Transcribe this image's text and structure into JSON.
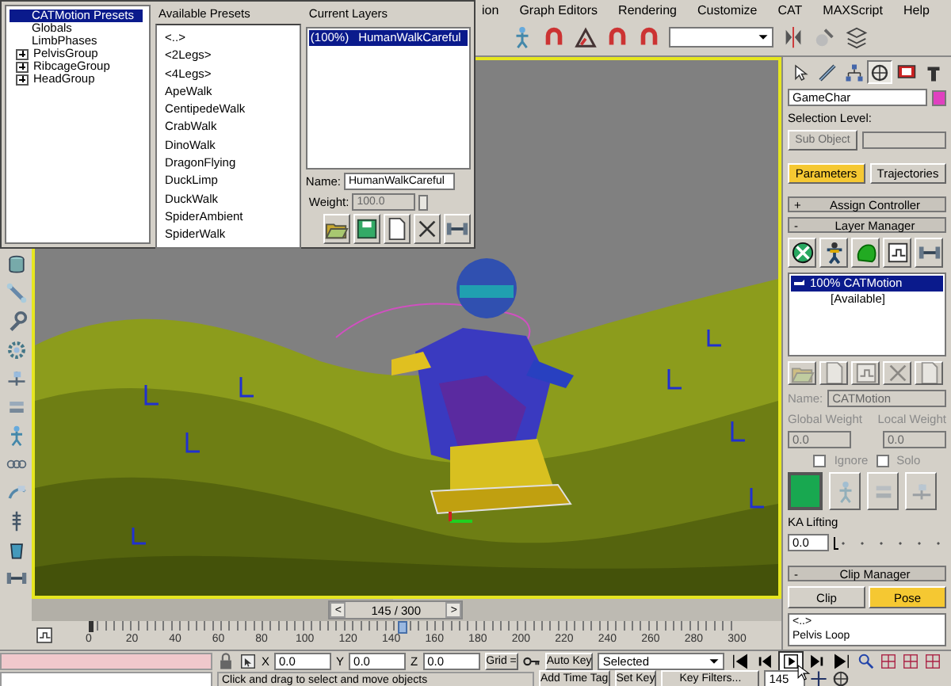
{
  "menu_bar": {
    "items": [
      "ion",
      "Graph Editors",
      "Rendering",
      "Customize",
      "CAT",
      "MAXScript",
      "Help"
    ]
  },
  "catmotion_window": {
    "tree": [
      {
        "label": "CATMotion Presets",
        "kind": "item",
        "selected": true,
        "children": [
          {
            "label": "Globals",
            "kind": "item",
            "selected": false
          },
          {
            "label": "LimbPhases",
            "kind": "item",
            "selected": false
          },
          {
            "label": "PelvisGroup",
            "kind": "group",
            "expanded": false,
            "selected": false
          },
          {
            "label": "RibcageGroup",
            "kind": "group",
            "expanded": false,
            "selected": false
          },
          {
            "label": "HeadGroup",
            "kind": "group",
            "expanded": false,
            "selected": false
          }
        ]
      }
    ],
    "available_presets": {
      "heading": "Available Presets",
      "items": [
        {
          "label": "<..>",
          "selected": false
        },
        {
          "label": "<2Legs>",
          "selected": false
        },
        {
          "label": "<4Legs>",
          "selected": false
        },
        {
          "label": "ApeWalk",
          "selected": false
        },
        {
          "label": "CentipedeWalk",
          "selected": false
        },
        {
          "label": "CrabWalk",
          "selected": false
        },
        {
          "label": "DinoWalk",
          "selected": false
        },
        {
          "label": "DragonFlying",
          "selected": false
        },
        {
          "label": "DuckLimp",
          "selected": false
        },
        {
          "label": "DuckWalk",
          "selected": false
        },
        {
          "label": "SpiderAmbient",
          "selected": false
        },
        {
          "label": "SpiderWalk",
          "selected": false
        }
      ]
    },
    "current_layers": {
      "heading": "Current Layers",
      "items": [
        {
          "weight": "(100%)",
          "name": "HumanWalkCareful",
          "selected": true
        }
      ]
    },
    "name": {
      "label": "Name:",
      "value": "HumanWalkCareful"
    },
    "weight": {
      "label": "Weight:",
      "value": "100.0",
      "disabled": true
    }
  },
  "command_panel": {
    "tabs": [
      {
        "selected": false
      },
      {
        "selected": false
      },
      {
        "selected": false
      },
      {
        "selected": true
      },
      {
        "selected": false
      },
      {
        "selected": false
      }
    ],
    "object_name": "GameChar",
    "selection_level": {
      "label": "Selection Level:",
      "dropdown": "Sub Object",
      "disabled": true
    },
    "mode_buttons": [
      {
        "label": "Parameters",
        "selected": true
      },
      {
        "label": "Trajectories",
        "selected": false
      }
    ],
    "rollouts": [
      {
        "sign": "+",
        "title": "Assign Controller"
      },
      {
        "sign": "-",
        "title": "Layer Manager"
      }
    ],
    "layers": [
      {
        "kind": "layer",
        "label": "100% CATMotion",
        "selected": true
      },
      {
        "kind": "slot",
        "label": "[Available]",
        "selected": false
      }
    ],
    "layer_properties": {
      "disabled": true,
      "name_label": "Name:",
      "name_value": "CATMotion",
      "global_weight_label": "Global Weight",
      "local_weight_label": "Local Weight",
      "global_weight": "0.0",
      "local_weight": "0.0",
      "checkboxes": [
        {
          "label": "Ignore",
          "checked": false
        },
        {
          "label": "Solo",
          "checked": false
        }
      ]
    },
    "ka_lifting": {
      "label": "KA Lifting",
      "value": "0.0",
      "level": 0
    },
    "clip_manager": {
      "sign": "-",
      "title": "Clip Manager",
      "buttons": [
        {
          "label": "Clip",
          "selected": false
        },
        {
          "label": "Pose",
          "selected": true
        }
      ],
      "items": [
        "<..>",
        "Pelvis Loop"
      ]
    }
  },
  "time_slider": {
    "prev": "<",
    "label": "145 / 300",
    "next": ">",
    "level": 0.483
  },
  "track_bar": {
    "ticks": [
      "0",
      "20",
      "40",
      "60",
      "80",
      "100",
      "120",
      "140",
      "160",
      "180",
      "200",
      "220",
      "240",
      "260",
      "280",
      "300"
    ],
    "level": 0.483
  },
  "status_bar": {
    "coords": [
      {
        "axis": "X",
        "value": "0.0"
      },
      {
        "axis": "Y",
        "value": "0.0"
      },
      {
        "axis": "Z",
        "value": "0.0"
      }
    ],
    "grid": "Grid =",
    "auto_key": "Auto Key",
    "key_mode": "Selected",
    "set_key": "Set Key",
    "key_filters": "Key Filters...",
    "frame": "145",
    "prompt": "Click and drag to select and move objects",
    "add_time_tag": "Add Time Tag"
  }
}
